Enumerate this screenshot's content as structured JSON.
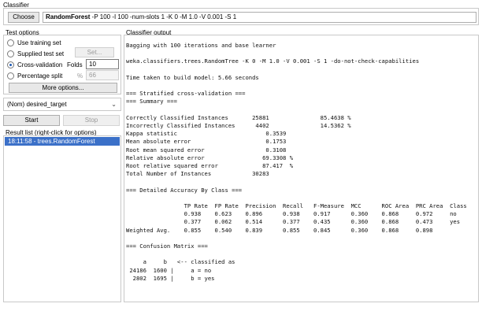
{
  "classifier": {
    "label": "Classifier",
    "choose_label": "Choose",
    "name": "RandomForest",
    "options": " -P 100 -I 100 -num-slots 1 -K 0 -M 1.0 -V 0.001 -S 1"
  },
  "test_options": {
    "label": "Test options",
    "use_training_set": "Use training set",
    "supplied_test_set": "Supplied test set",
    "set_label": "Set...",
    "cross_validation": "Cross-validation",
    "folds_label": "Folds",
    "folds_value": "10",
    "percentage_split": "Percentage split",
    "percent_symbol": "%",
    "percent_value": "66",
    "more_options_label": "More options...",
    "selected": "cross_validation"
  },
  "target": {
    "value": "(Nom) desired_target"
  },
  "controls": {
    "start_label": "Start",
    "stop_label": "Stop"
  },
  "result_list": {
    "label": "Result list (right-click for options)",
    "items": [
      "18:11:58 - trees.RandomForest"
    ]
  },
  "output": {
    "label": "Classifier output",
    "text": "Bagging with 100 iterations and base learner\n\nweka.classifiers.trees.RandomTree -K 0 -M 1.0 -V 0.001 -S 1 -do-not-check-capabilities\n\nTime taken to build model: 5.66 seconds\n\n=== Stratified cross-validation ===\n=== Summary ===\n\nCorrectly Classified Instances       25881               85.4638 %\nIncorrectly Classified Instances      4402               14.5362 %\nKappa statistic                          0.3539\nMean absolute error                      0.1753\nRoot mean squared error                  0.3108\nRelative absolute error                 69.3308 %\nRoot relative squared error             87.417  %\nTotal Number of Instances            30283\n\n=== Detailed Accuracy By Class ===\n\n                 TP Rate  FP Rate  Precision  Recall   F-Measure  MCC      ROC Area  PRC Area  Class\n                 0.938    0.623    0.896      0.938    0.917      0.360    0.868     0.972     no\n                 0.377    0.062    0.514      0.377    0.435      0.360    0.868     0.473     yes\nWeighted Avg.    0.855    0.540    0.839      0.855    0.845      0.360    0.868     0.898\n\n=== Confusion Matrix ===\n\n     a     b   <-- classified as\n 24186  1600 |     a = no\n  2802  1695 |     b = yes"
  }
}
